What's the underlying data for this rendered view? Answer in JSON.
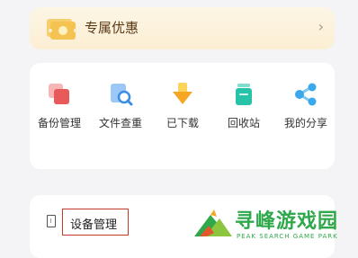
{
  "promo": {
    "label": "专属优惠",
    "chevron": "›"
  },
  "tools": [
    {
      "label": "备份管理",
      "icon": "backup-icon"
    },
    {
      "label": "文件查重",
      "icon": "duplicate-search-icon"
    },
    {
      "label": "已下载",
      "icon": "download-icon"
    },
    {
      "label": "回收站",
      "icon": "recycle-bin-icon"
    },
    {
      "label": "我的分享",
      "icon": "share-icon"
    }
  ],
  "device": {
    "label": "设备管理",
    "icon": "device-icon"
  },
  "watermark": {
    "title": "寻峰游戏园",
    "subtitle": "PEAK SEARCH GAME PARK"
  },
  "colors": {
    "background": "#f4f4f6",
    "accent_green": "#2ea84b",
    "highlight_red": "#c0392b",
    "promo_bg": "#fbeed3"
  }
}
